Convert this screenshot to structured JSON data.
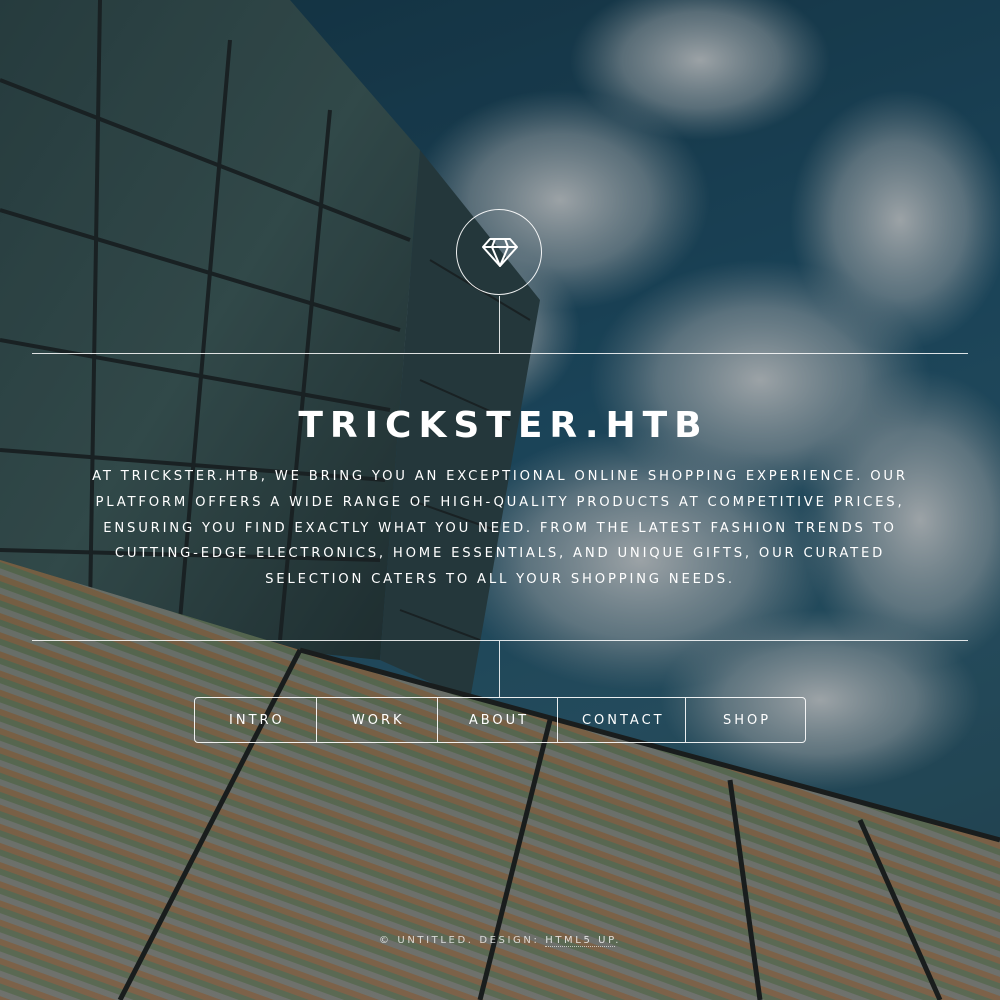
{
  "header": {
    "logo_icon": "diamond-icon",
    "title": "TRICKSTER.HTB",
    "description": "At Trickster.htb, we bring you an exceptional online shopping experience. Our platform offers a wide range of high-quality products at competitive prices, ensuring you find exactly what you need. From the latest fashion trends to cutting-edge electronics, home essentials, and unique gifts, our curated selection caters to all your shopping needs."
  },
  "nav": {
    "items": [
      {
        "label": "INTRO"
      },
      {
        "label": "WORK"
      },
      {
        "label": "ABOUT"
      },
      {
        "label": "CONTACT"
      },
      {
        "label": "SHOP"
      }
    ]
  },
  "footer": {
    "copyright": "© UNTITLED.",
    "design_label": "DESIGN:",
    "design_link": "HTML5 UP",
    "end": "."
  },
  "colors": {
    "text": "#ffffff",
    "sky": "#1c5571",
    "overlay": "#161a1e"
  }
}
